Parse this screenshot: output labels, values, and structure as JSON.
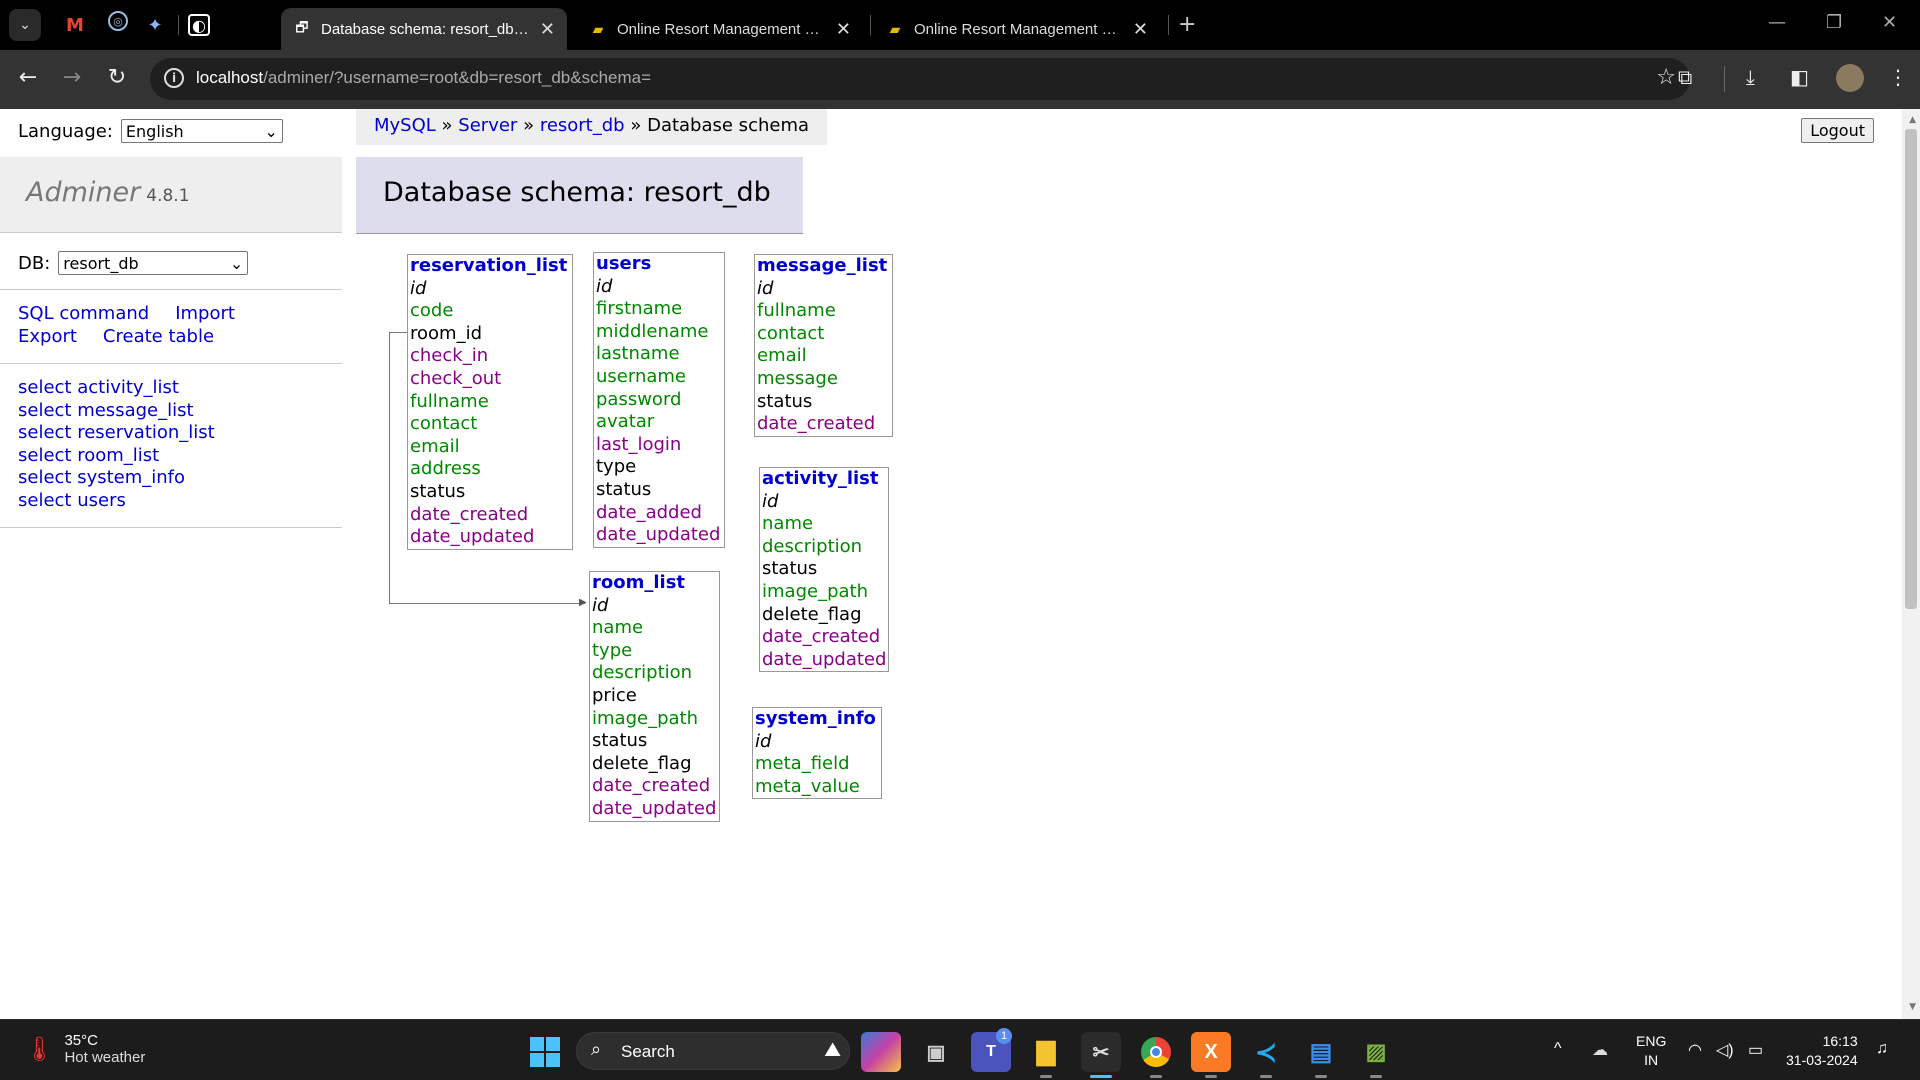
{
  "browser": {
    "tabs": [
      {
        "title": "Database schema: resort_db - Adminer",
        "active": true
      },
      {
        "title": "Online Resort Management System",
        "active": false
      },
      {
        "title": "Online Resort Management System",
        "active": false
      }
    ],
    "url_host": "localhost",
    "url_path": "/adminer/?username=root&db=resort_db&schema="
  },
  "page": {
    "language_label": "Language:",
    "language_value": "English",
    "breadcrumb": {
      "mysql": "MySQL",
      "sep1": "»",
      "server": "Server",
      "sep2": "»",
      "db": "resort_db",
      "sep3": "»",
      "current": "Database schema"
    },
    "logout_label": "Logout",
    "brand": "Adminer",
    "version": "4.8.1",
    "db_label": "DB:",
    "db_value": "resort_db",
    "commands": [
      "SQL command",
      "Import",
      "Export",
      "Create table"
    ],
    "table_links": [
      "select activity_list",
      "select message_list",
      "select reservation_list",
      "select room_list",
      "select system_info",
      "select users"
    ],
    "title": "Database schema: resort_db"
  },
  "schema": {
    "reservation_list": {
      "name": "reservation_list",
      "columns": [
        "id",
        "code",
        "room_id",
        "check_in",
        "check_out",
        "fullname",
        "contact",
        "email",
        "address",
        "status",
        "date_created",
        "date_updated"
      ]
    },
    "users": {
      "name": "users",
      "columns": [
        "id",
        "firstname",
        "middlename",
        "lastname",
        "username",
        "password",
        "avatar",
        "last_login",
        "type",
        "status",
        "date_added",
        "date_updated"
      ]
    },
    "message_list": {
      "name": "message_list",
      "columns": [
        "id",
        "fullname",
        "contact",
        "email",
        "message",
        "status",
        "date_created"
      ]
    },
    "activity_list": {
      "name": "activity_list",
      "columns": [
        "id",
        "name",
        "description",
        "status",
        "image_path",
        "delete_flag",
        "date_created",
        "date_updated"
      ]
    },
    "room_list": {
      "name": "room_list",
      "columns": [
        "id",
        "name",
        "type",
        "description",
        "price",
        "image_path",
        "status",
        "delete_flag",
        "date_created",
        "date_updated"
      ]
    },
    "system_info": {
      "name": "system_info",
      "columns": [
        "id",
        "meta_field",
        "meta_value"
      ]
    }
  },
  "taskbar": {
    "temperature": "35°C",
    "weather": "Hot weather",
    "search_label": "Search",
    "lang_line1": "ENG",
    "lang_line2": "IN",
    "time": "16:13",
    "date": "31-03-2024",
    "teams_badge": "1"
  },
  "colors": {
    "link": "#0000cc",
    "column_text": "#008800",
    "column_date": "#880088",
    "title_bg": "#ddddee",
    "windows_accent": "#4cc2ff"
  },
  "icons": [
    "gmail-icon",
    "chatgpt-icon",
    "gemini-icon",
    "pinned-app-icon",
    "adminer-favicon",
    "resort-favicon",
    "info-icon",
    "star-icon",
    "extensions-icon",
    "download-icon",
    "sidepanel-icon",
    "profile-avatar",
    "menu-icon",
    "thermometer-icon",
    "windows-start-icon",
    "search-icon",
    "wifi-icon",
    "volume-icon",
    "battery-icon",
    "bell-icon"
  ]
}
